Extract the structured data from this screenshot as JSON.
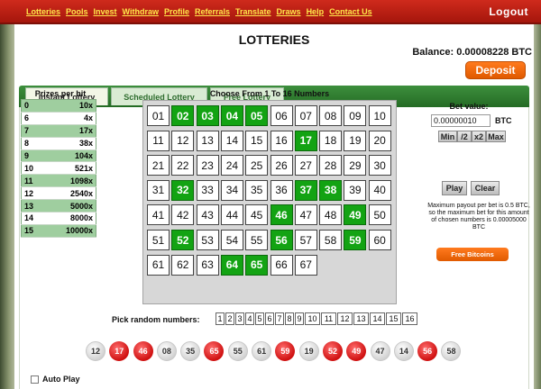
{
  "nav": {
    "links": [
      "Lotteries",
      "Pools",
      "Invest",
      "Withdraw",
      "Profile",
      "Referrals",
      "Translate",
      "Draws",
      "Help",
      "Contact Us"
    ],
    "logout": "Logout"
  },
  "page": {
    "title": "LOTTERIES",
    "balance": "Balance: 0.00008228 BTC",
    "deposit": "Deposit"
  },
  "tabs": [
    {
      "label": "Instant Lottery",
      "active": true
    },
    {
      "label": "Scheduled Lottery",
      "active": false
    },
    {
      "label": "Free Lottery",
      "active": false
    }
  ],
  "prizes": {
    "title": "Prizes per hit",
    "rows": [
      {
        "hits": "0",
        "mult": "10x"
      },
      {
        "hits": "6",
        "mult": "4x"
      },
      {
        "hits": "7",
        "mult": "17x"
      },
      {
        "hits": "8",
        "mult": "38x"
      },
      {
        "hits": "9",
        "mult": "104x"
      },
      {
        "hits": "10",
        "mult": "521x"
      },
      {
        "hits": "11",
        "mult": "1098x"
      },
      {
        "hits": "12",
        "mult": "2540x"
      },
      {
        "hits": "13",
        "mult": "5000x"
      },
      {
        "hits": "14",
        "mult": "8000x"
      },
      {
        "hits": "15",
        "mult": "10000x"
      }
    ]
  },
  "grid": {
    "title": "Choose From 1 To 16 Numbers",
    "numbers": [
      "01",
      "02",
      "03",
      "04",
      "05",
      "06",
      "07",
      "08",
      "09",
      "10",
      "11",
      "12",
      "13",
      "14",
      "15",
      "16",
      "17",
      "18",
      "19",
      "20",
      "21",
      "22",
      "23",
      "24",
      "25",
      "26",
      "27",
      "28",
      "29",
      "30",
      "31",
      "32",
      "33",
      "34",
      "35",
      "36",
      "37",
      "38",
      "39",
      "40",
      "41",
      "42",
      "43",
      "44",
      "45",
      "46",
      "47",
      "48",
      "49",
      "50",
      "51",
      "52",
      "53",
      "54",
      "55",
      "56",
      "57",
      "58",
      "59",
      "60",
      "61",
      "62",
      "63",
      "64",
      "65",
      "66",
      "67"
    ],
    "selected": [
      "02",
      "03",
      "04",
      "05",
      "17",
      "32",
      "37",
      "38",
      "46",
      "49",
      "52",
      "56",
      "59",
      "64",
      "65"
    ]
  },
  "bet": {
    "label": "Bet value:",
    "value": "0.00000010",
    "unit": "BTC",
    "buttons": [
      "Min",
      "/2",
      "x2",
      "Max"
    ],
    "play": "Play",
    "clear": "Clear",
    "note": "Maximum payout per bet is 0.5 BTC, so the maximum bet for this amount of chosen numbers is 0.00005000 BTC",
    "free_bitcoins": "Free Bitcoins"
  },
  "random": {
    "label": "Pick random numbers:",
    "options": [
      "1",
      "2",
      "3",
      "4",
      "5",
      "6",
      "7",
      "8",
      "9",
      "10",
      "11",
      "12",
      "13",
      "14",
      "15",
      "16"
    ]
  },
  "drawn_balls": [
    {
      "n": "12",
      "color": "white"
    },
    {
      "n": "17",
      "color": "red"
    },
    {
      "n": "46",
      "color": "red"
    },
    {
      "n": "08",
      "color": "white"
    },
    {
      "n": "35",
      "color": "white"
    },
    {
      "n": "65",
      "color": "red"
    },
    {
      "n": "55",
      "color": "white"
    },
    {
      "n": "61",
      "color": "white"
    },
    {
      "n": "59",
      "color": "red"
    },
    {
      "n": "19",
      "color": "white"
    },
    {
      "n": "52",
      "color": "red"
    },
    {
      "n": "49",
      "color": "red"
    },
    {
      "n": "47",
      "color": "white"
    },
    {
      "n": "14",
      "color": "white"
    },
    {
      "n": "56",
      "color": "red"
    },
    {
      "n": "58",
      "color": "white"
    }
  ],
  "autoplay": {
    "label": "Auto Play"
  },
  "colors": {
    "nav_bg": "#c0201a",
    "nav_link": "#ffe74a",
    "selected_cell": "#13a313",
    "accent": "#f26a0a"
  }
}
